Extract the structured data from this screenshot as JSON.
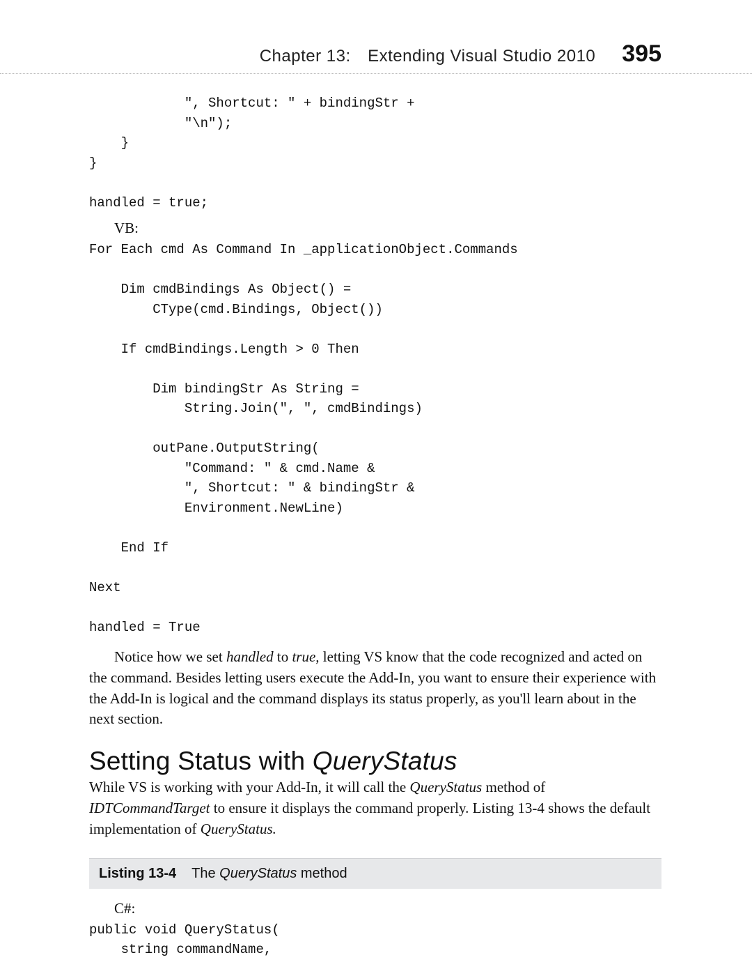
{
  "header": {
    "chapter": "Chapter 13: Extending Visual Studio 2010",
    "page_number": "395"
  },
  "code_block_cs_tail": "            \", Shortcut: \" + bindingStr +\n            \"\\n\");\n    }\n}\n\nhandled = true;",
  "vb_label": "VB:",
  "code_block_vb": "For Each cmd As Command In _applicationObject.Commands\n\n    Dim cmdBindings As Object() =\n        CType(cmd.Bindings, Object())\n\n    If cmdBindings.Length > 0 Then\n\n        Dim bindingStr As String =\n            String.Join(\", \", cmdBindings)\n\n        outPane.OutputString(\n            \"Command: \" & cmd.Name &\n            \", Shortcut: \" & bindingStr &\n            Environment.NewLine)\n\n    End If\n\nNext\n\nhandled = True",
  "para1_a": "Notice how we set ",
  "para1_b": "handled",
  "para1_c": " to ",
  "para1_d": "true,",
  "para1_e": " letting VS know that the code recognized and acted on the command. Besides letting users execute the Add-In, you want to ensure their experience with the Add-In is logical and the command displays its status properly, as you'll learn about in the next section.",
  "heading_a": "Setting Status with ",
  "heading_b": "QueryStatus",
  "para2_a": "While VS is working with your Add-In, it will call the ",
  "para2_b": "QueryStatus",
  "para2_c": " method of ",
  "para2_d": "IDTCommandTarget",
  "para2_e": " to ensure it displays the command properly. Listing 13-4 shows the default implementation of ",
  "para2_f": "QueryStatus.",
  "listing": {
    "label": "Listing 13-4",
    "title_a": "The ",
    "title_b": "QueryStatus",
    "title_c": " method"
  },
  "cs_label": "C#:",
  "code_block_cs2": "public void QueryStatus(\n    string commandName,"
}
